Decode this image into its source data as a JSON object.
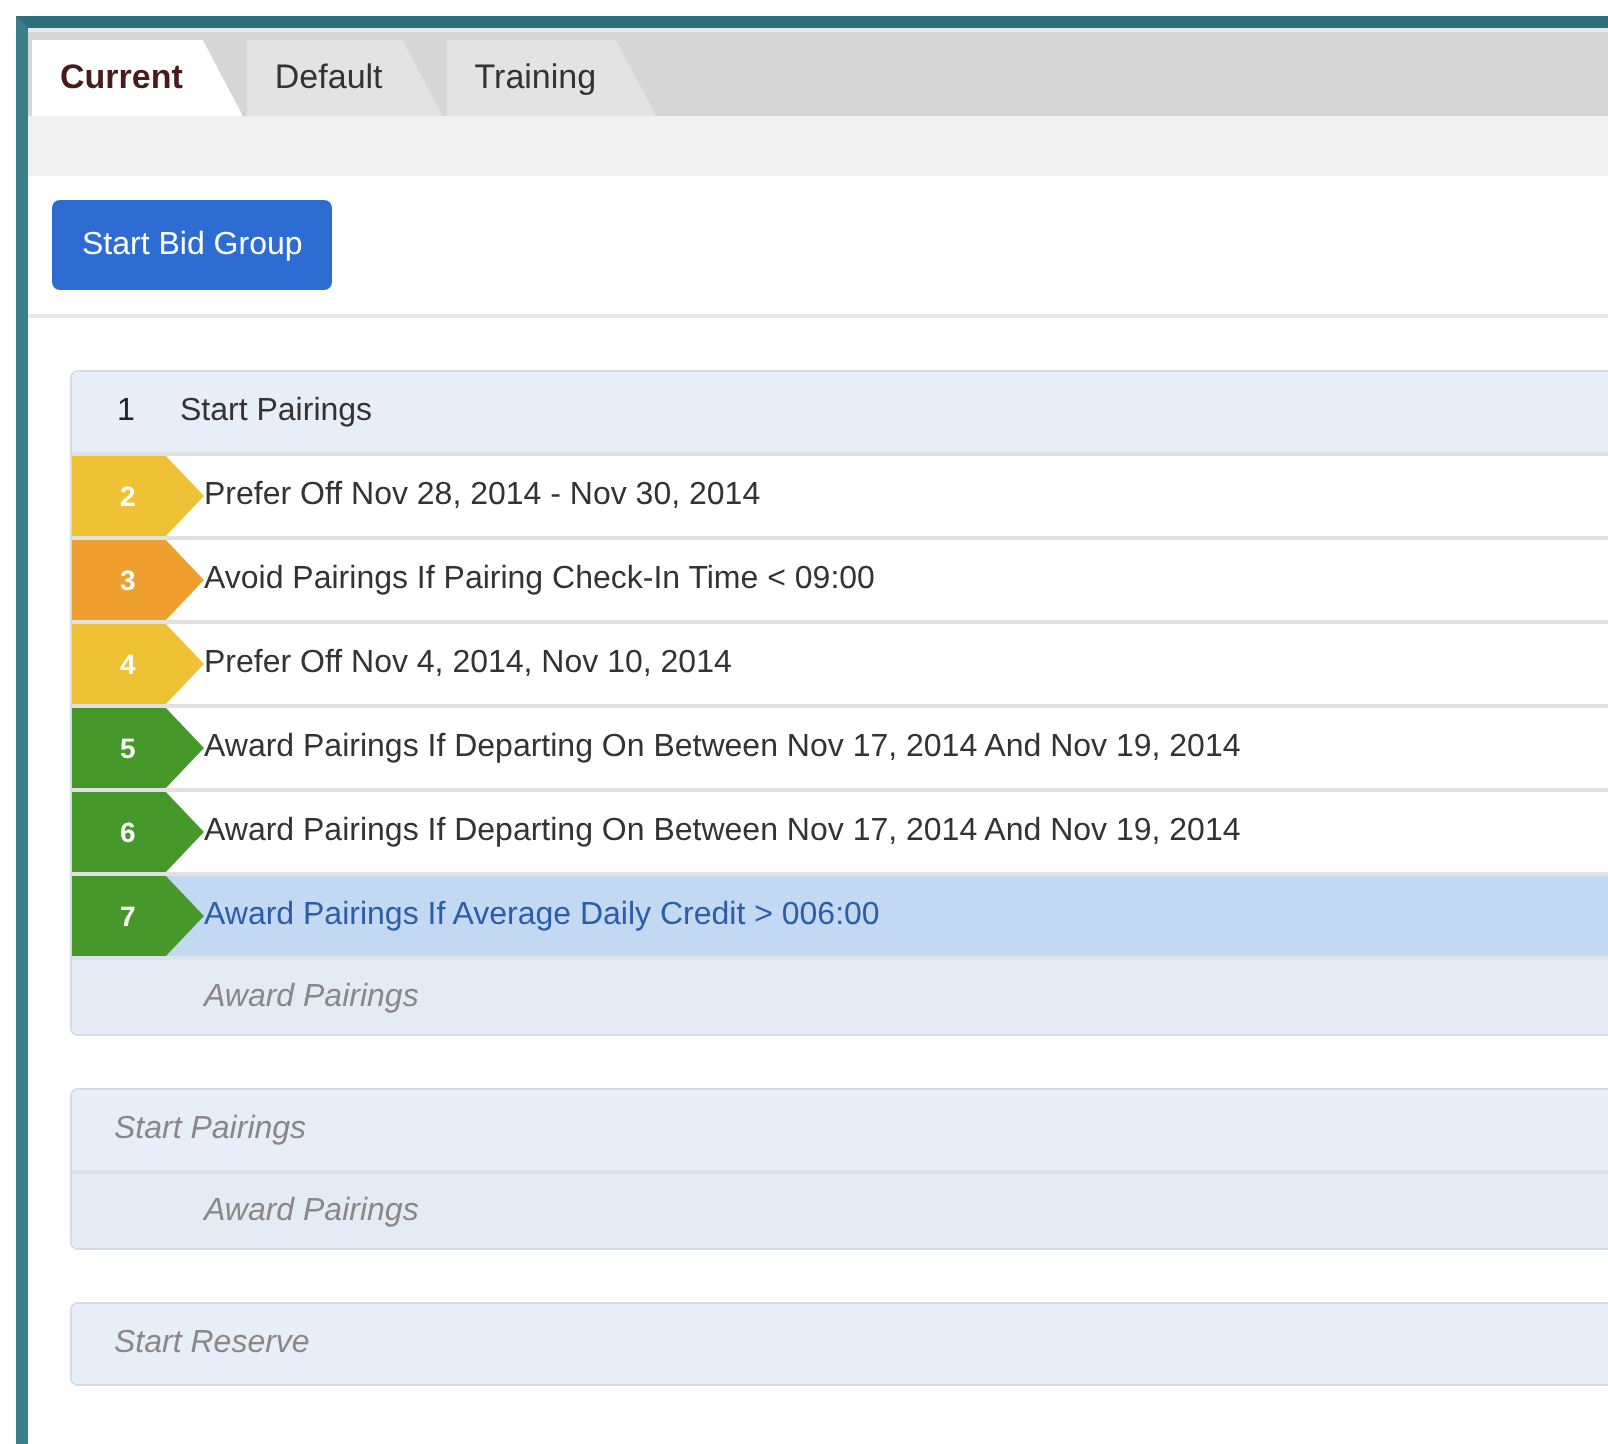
{
  "tabs": [
    {
      "label": "Current",
      "selected": true
    },
    {
      "label": "Default",
      "selected": false
    },
    {
      "label": "Training",
      "selected": false
    }
  ],
  "start_button": "Start Bid Group",
  "groups": [
    {
      "kind": "filled",
      "header": {
        "number": "1",
        "label": "Start Pairings"
      },
      "rules": [
        {
          "number": "2",
          "label": "Prefer Off Nov 28, 2014 - Nov 30, 2014",
          "color": "#efc236",
          "selected": false
        },
        {
          "number": "3",
          "label": "Avoid Pairings If Pairing Check-In Time < 09:00",
          "color": "#ee9f2e",
          "selected": false
        },
        {
          "number": "4",
          "label": "Prefer Off Nov 4, 2014, Nov 10, 2014",
          "color": "#efc236",
          "selected": false
        },
        {
          "number": "5",
          "label": "Award Pairings If Departing On Between Nov 17, 2014 And Nov 19, 2014",
          "color": "#46982a",
          "selected": false
        },
        {
          "number": "6",
          "label": "Award Pairings If Departing On Between Nov 17, 2014 And Nov 19, 2014",
          "color": "#46982a",
          "selected": false
        },
        {
          "number": "7",
          "label": "Award Pairings If Average Daily Credit > 006:00",
          "color": "#46982a",
          "selected": true
        }
      ],
      "footer": "Award Pairings"
    },
    {
      "kind": "empty",
      "header": {
        "label": "Start Pairings"
      },
      "footer": "Award Pairings"
    },
    {
      "kind": "empty",
      "header": {
        "label": "Start Reserve"
      }
    }
  ]
}
